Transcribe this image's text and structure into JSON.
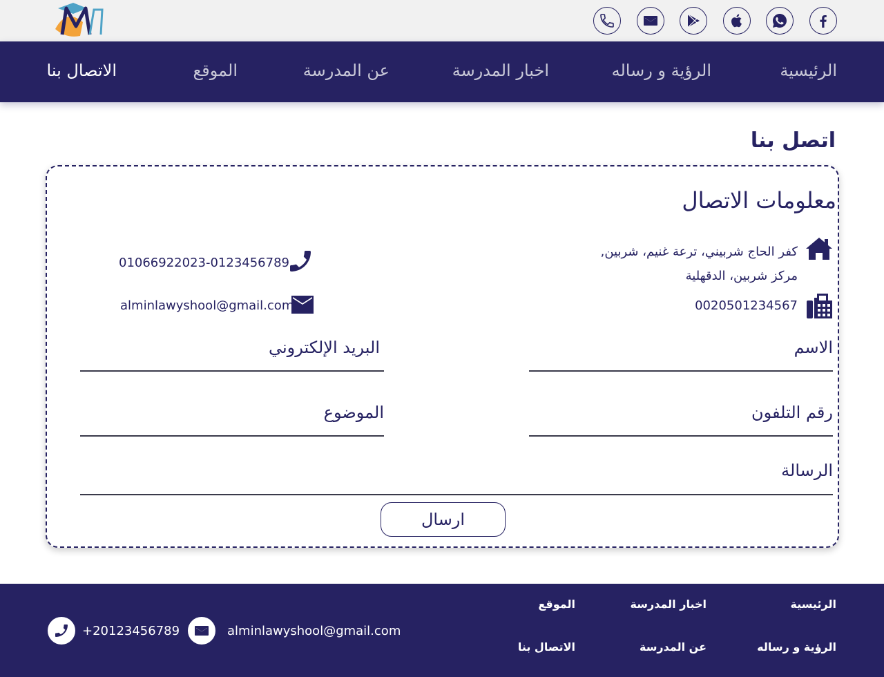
{
  "colors": {
    "brand": "#262262",
    "topbar": "#f1f1f1",
    "nav_inactive": "#c9c9d8",
    "white": "#ffffff"
  },
  "topbar": {
    "icons": [
      "phone-icon",
      "mail-icon",
      "google-play-icon",
      "apple-icon",
      "whatsapp-icon",
      "facebook-icon"
    ]
  },
  "nav": {
    "items": [
      {
        "label": "الرئيسية",
        "active": false
      },
      {
        "label": "الرؤية و رساله",
        "active": false
      },
      {
        "label": "اخبار المدرسة",
        "active": false
      },
      {
        "label": "عن المدرسة",
        "active": false
      },
      {
        "label": "الموقع",
        "active": false
      },
      {
        "label": "الاتصال بنا",
        "active": true
      }
    ]
  },
  "page": {
    "title": "اتصل بنا"
  },
  "contact_info": {
    "title": "معلومات الاتصال",
    "address_line1": "كفر الحاج شربيني، ترعة غنيم، شربين,",
    "address_line2": "مركز شربين، الدقهلية",
    "fax": "0020501234567",
    "phone": "01066922023-0123456789",
    "email": "alminlawyshool@gmail.com"
  },
  "form": {
    "name_label": "الاسم",
    "email_label": "البريد الإلكتروني",
    "phone_label": "رقم التلفون",
    "subject_label": "الموضوع",
    "message_label": "الرسالة",
    "send_label": "ارسال"
  },
  "footer": {
    "links": {
      "home": "الرئيسية",
      "vision": "الرؤية و رساله",
      "news": "اخبار المدرسة",
      "about": "عن المدرسة",
      "location": "الموقع",
      "contact": "الاتصال بنا"
    },
    "email": "alminlawyshool@gmail.com",
    "phone": "+20123456789"
  }
}
